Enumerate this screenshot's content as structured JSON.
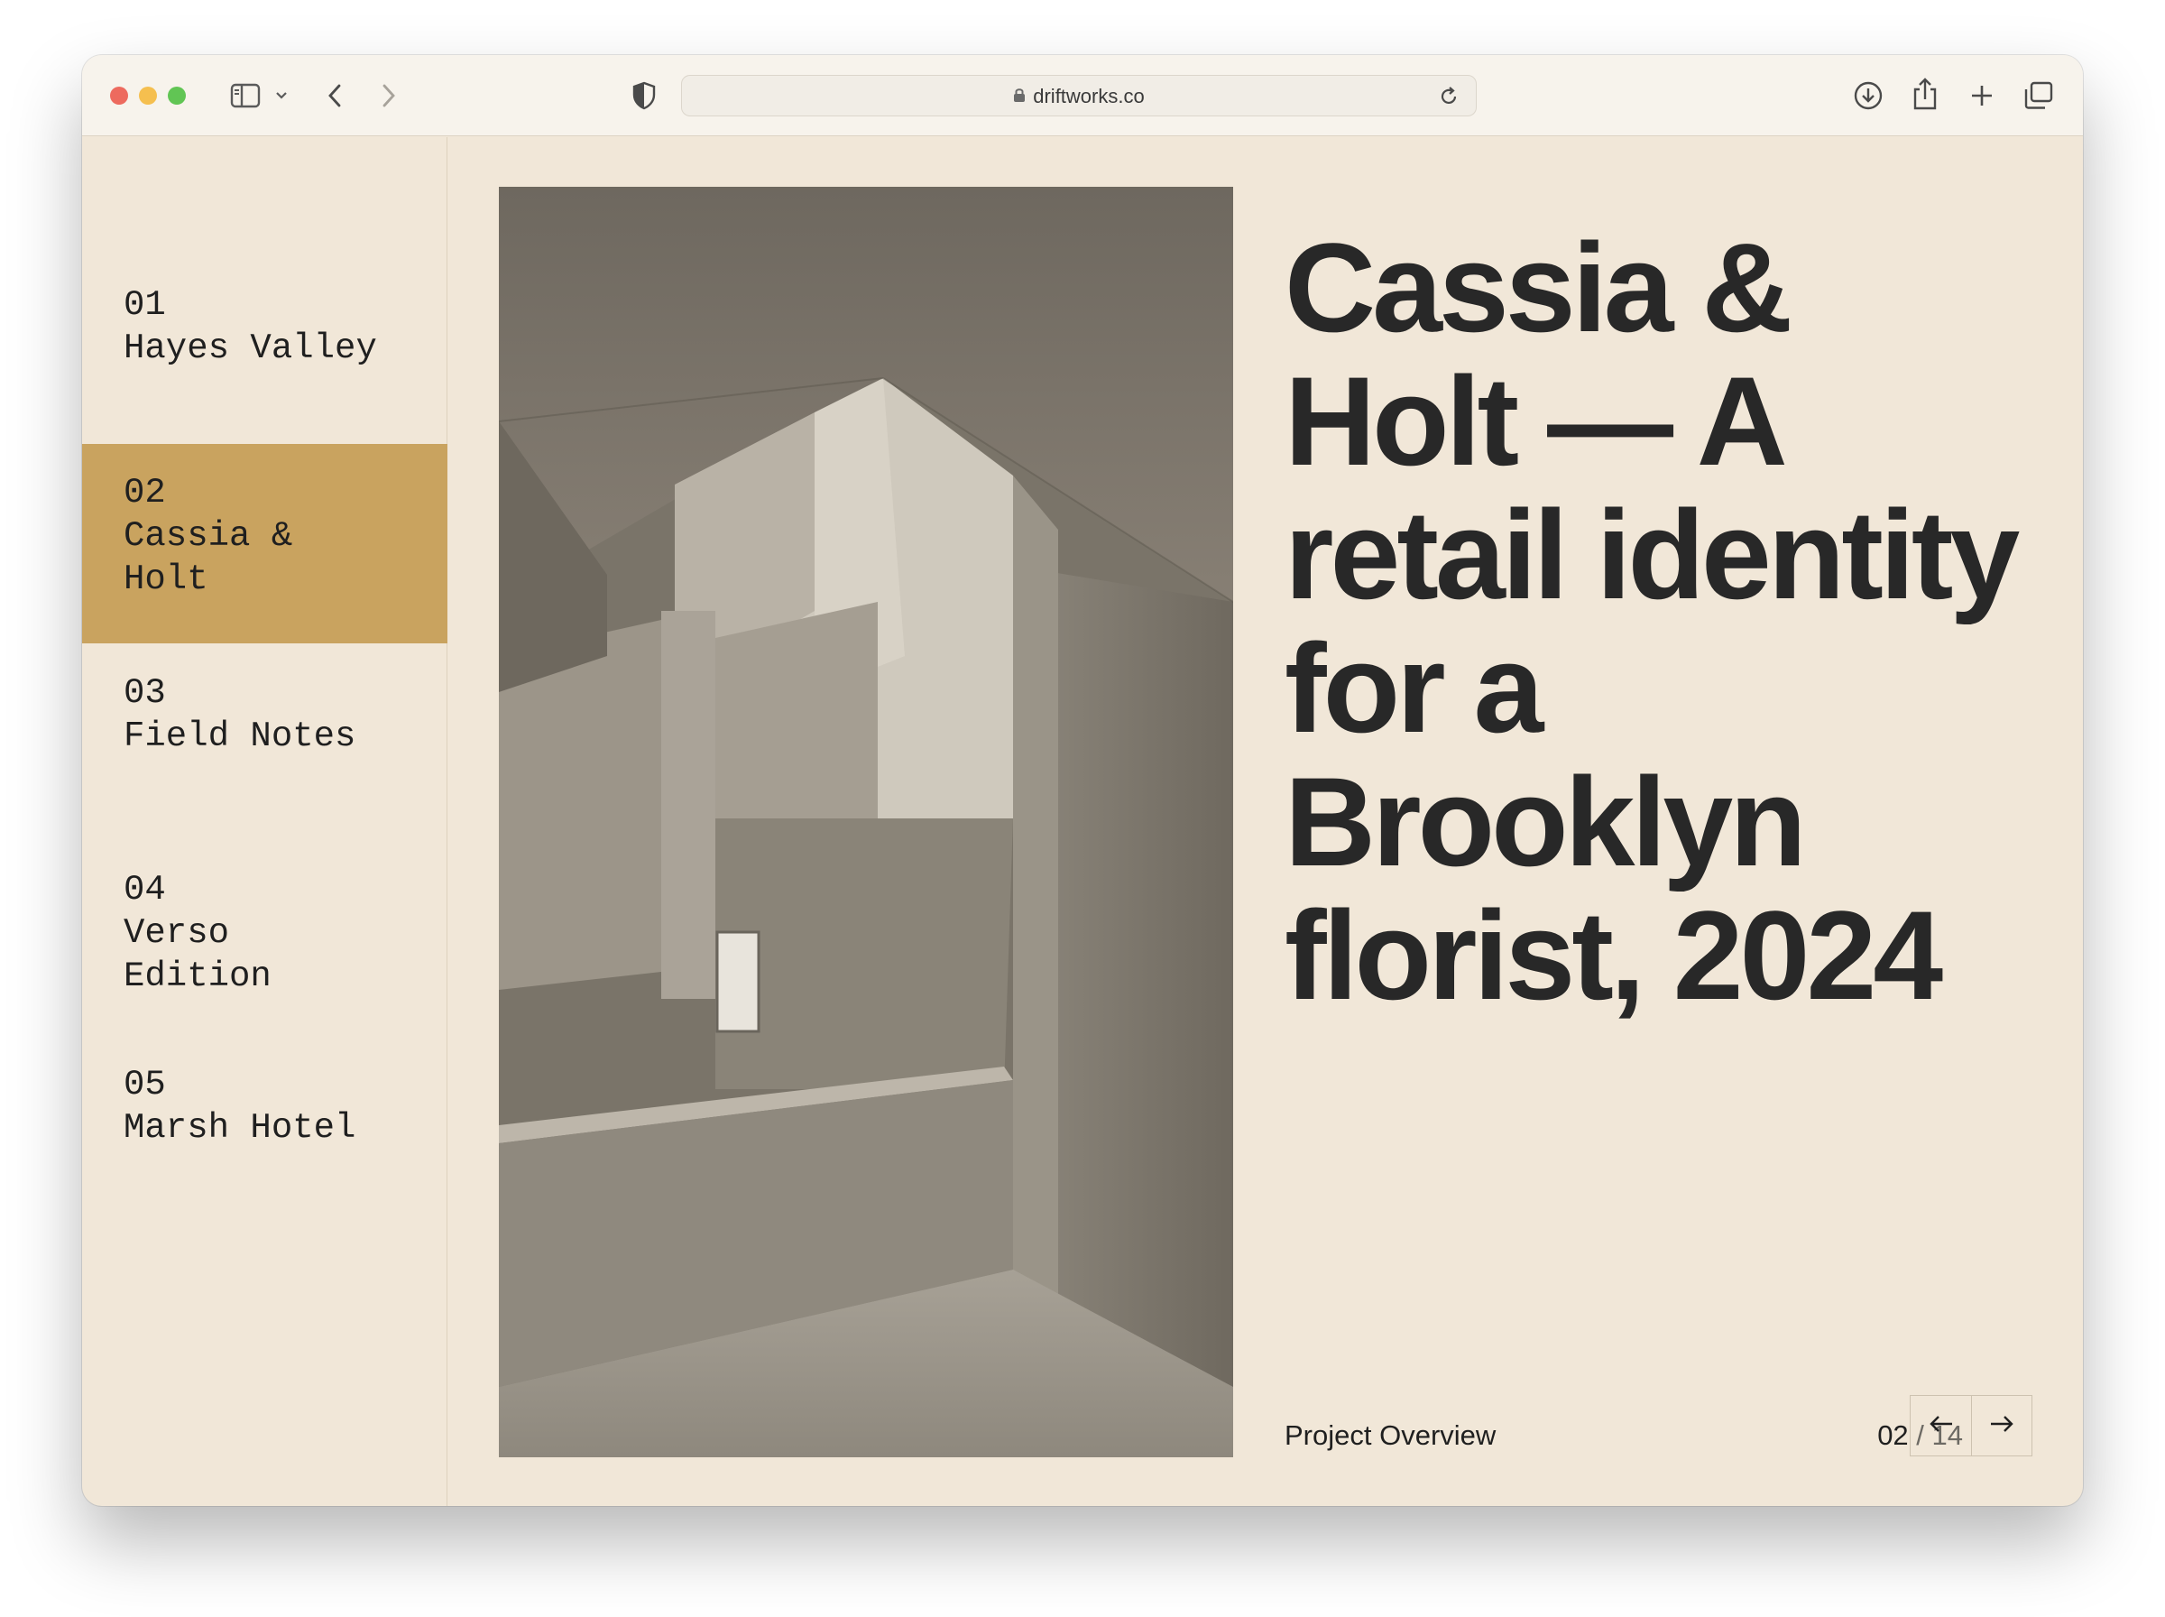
{
  "browser": {
    "url": "driftworks.co",
    "icons": [
      "sidebar-toggle-icon",
      "chevron-down-icon",
      "back-icon",
      "forward-icon",
      "shield-icon",
      "lock-icon",
      "reload-icon",
      "download-icon",
      "share-icon",
      "new-tab-icon",
      "tabs-overview-icon"
    ]
  },
  "sidebar": {
    "items": [
      {
        "number": "01",
        "label": "Hayes Valley",
        "active": false
      },
      {
        "number": "02",
        "label": "Cassia & Holt",
        "active": true
      },
      {
        "number": "03",
        "label": "Field Notes",
        "active": false
      },
      {
        "number": "04",
        "label": "Verso Edition",
        "active": false
      },
      {
        "number": "05",
        "label": "Marsh Hotel",
        "active": false
      }
    ]
  },
  "main": {
    "headline": "Cassia & Holt — A retail identity for a Brooklyn florist, 2024",
    "section_label": "Project Overview",
    "counter": {
      "current": "02",
      "separator": " / ",
      "total": "14"
    }
  },
  "colors": {
    "background": "#f1e7d8",
    "accent": "#c9a35f",
    "text": "#282828"
  }
}
